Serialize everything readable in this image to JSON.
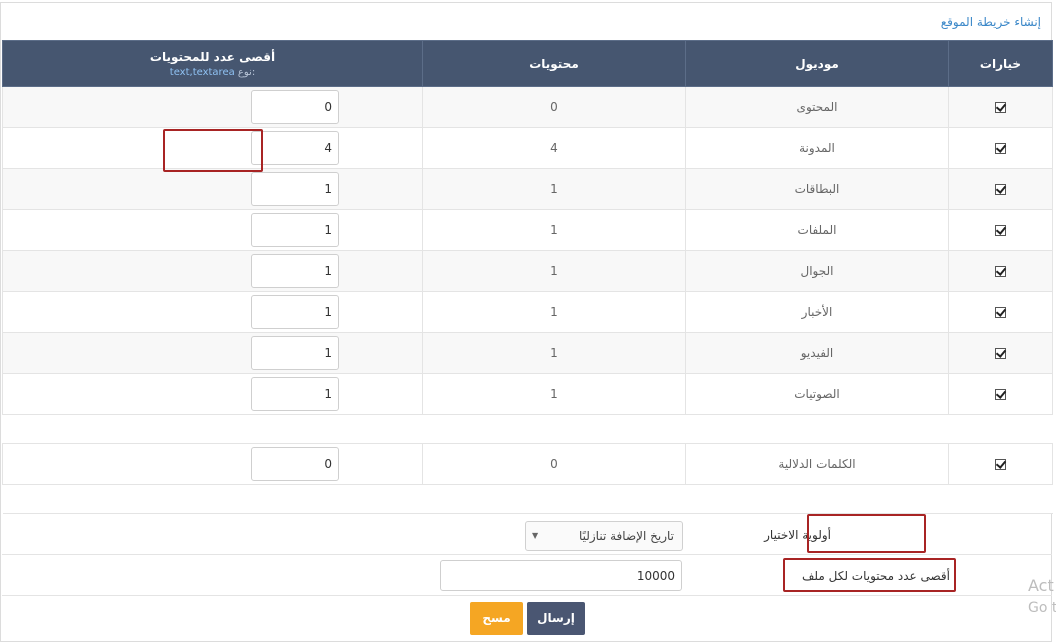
{
  "breadcrumb": "إنشاء خريطة الموقع",
  "table": {
    "headers": {
      "options": "خيارات",
      "module": "موديول",
      "contents": "محتويات",
      "max_contents": "أقصى عدد للمحتويات",
      "type_key": "نوع:",
      "type_value": "text,textarea"
    },
    "rows": [
      {
        "checked": true,
        "module": "المحتوى",
        "contents": "0",
        "max": "0"
      },
      {
        "checked": true,
        "module": "المدونة",
        "contents": "4",
        "max": "4"
      },
      {
        "checked": true,
        "module": "البطاقات",
        "contents": "1",
        "max": "1"
      },
      {
        "checked": true,
        "module": "الملفات",
        "contents": "1",
        "max": "1"
      },
      {
        "checked": true,
        "module": "الجوال",
        "contents": "1",
        "max": "1"
      },
      {
        "checked": true,
        "module": "الأخبار",
        "contents": "1",
        "max": "1"
      },
      {
        "checked": true,
        "module": "الفيديو",
        "contents": "1",
        "max": "1"
      },
      {
        "checked": true,
        "module": "الصوتيات",
        "contents": "1",
        "max": "1"
      }
    ],
    "keywords_row": {
      "checked": true,
      "module": "الكلمات الدلالية",
      "contents": "0",
      "max": "0"
    }
  },
  "settings": {
    "priority_label": "أولوية الاختيار",
    "priority_value": "تاريخ الإضافة تنازليًا",
    "max_per_file_label": "أقصى عدد محتويات لكل ملف",
    "max_per_file_value": "10000"
  },
  "buttons": {
    "submit": "إرسال",
    "clear": "مسح"
  },
  "watermark": {
    "line1": "Act",
    "line2": "Go t"
  },
  "colors": {
    "header_bg": "#465670",
    "submit_bg": "#4a5672",
    "clear_bg": "#f5a623",
    "highlight_border": "#a82424",
    "link": "#3a87c8"
  }
}
